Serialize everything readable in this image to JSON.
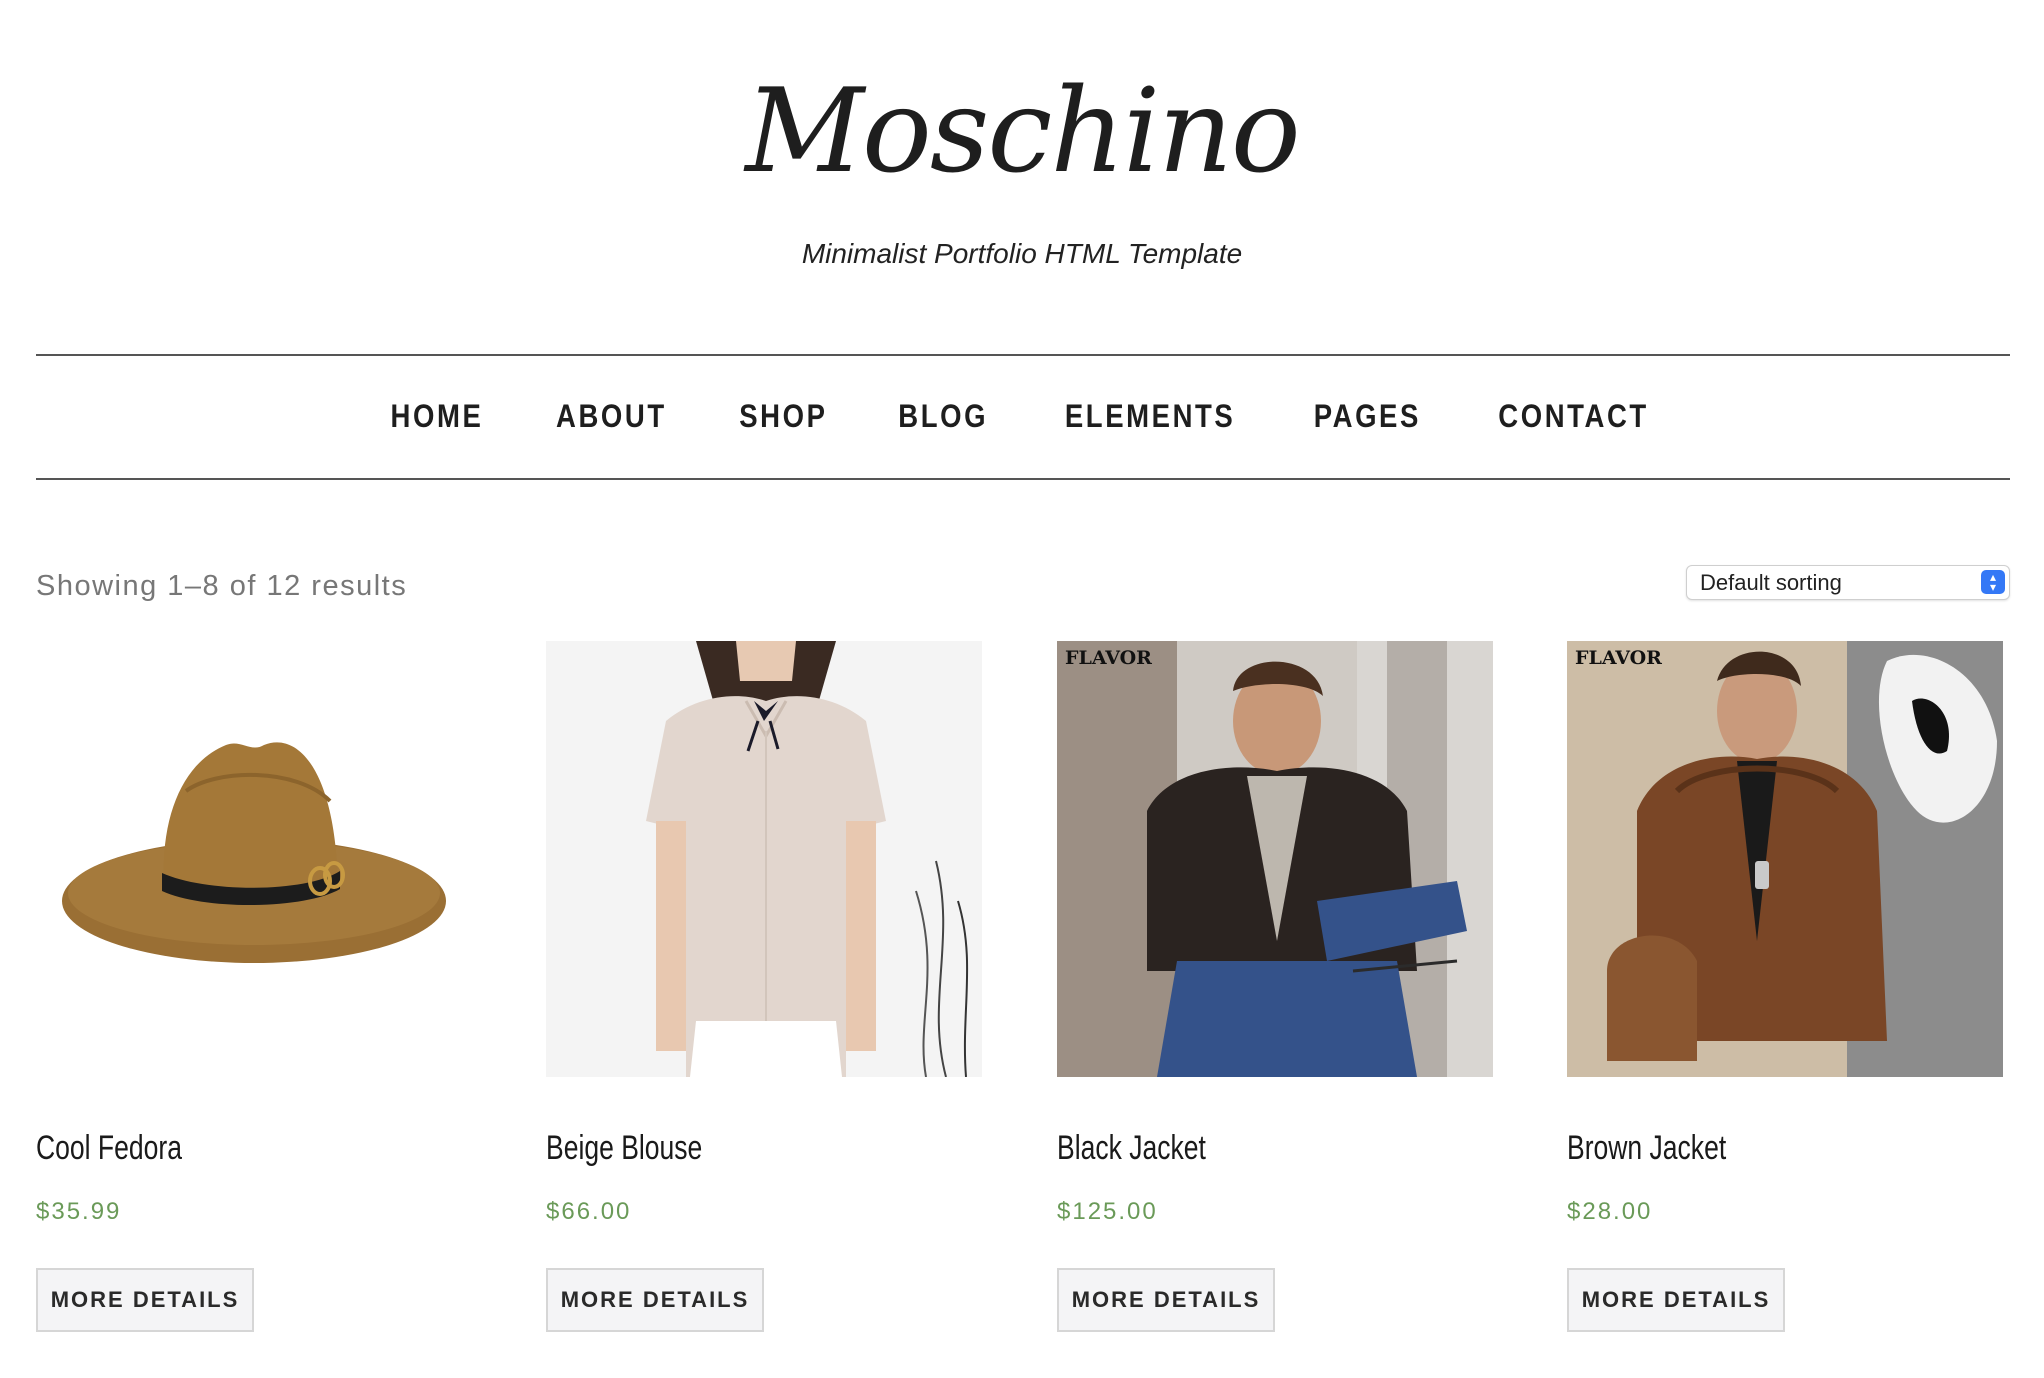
{
  "site": {
    "logo": "Moschino",
    "tagline": "Minimalist Portfolio HTML Template"
  },
  "nav": {
    "items": [
      "HOME",
      "ABOUT",
      "SHOP",
      "BLOG",
      "ELEMENTS",
      "PAGES",
      "CONTACT"
    ]
  },
  "shop": {
    "result_count": "Showing 1–8 of 12 results",
    "sort_selected": "Default sorting",
    "button_label": "MORE DETAILS",
    "products": [
      {
        "title": "Cool Fedora",
        "price": "$35.99",
        "image": "fedora-hat"
      },
      {
        "title": "Beige Blouse",
        "price": "$66.00",
        "image": "beige-blouse"
      },
      {
        "title": "Black Jacket",
        "price": "$125.00",
        "image": "black-leather-jacket",
        "badge": "FLAVOR"
      },
      {
        "title": "Brown Jacket",
        "price": "$28.00",
        "image": "brown-leather-jacket",
        "badge": "FLAVOR"
      }
    ]
  },
  "colors": {
    "price": "#6a9a58",
    "rule": "#555555",
    "button_bg": "#f4f4f6",
    "select_accent": "#3478f6"
  }
}
